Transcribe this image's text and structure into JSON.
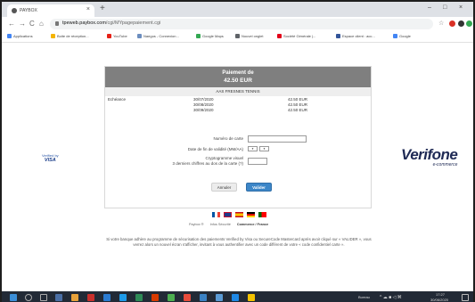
{
  "browser": {
    "tab_title": "PAYBOX",
    "tab_close": "×",
    "new_tab": "+",
    "window_controls": [
      "–",
      "□",
      "×"
    ],
    "url_host": "tpeweb.paybox.com",
    "url_path": "/cgi/MYpagepaiement.cgi",
    "bookmarks": [
      {
        "label": "Applications",
        "color": "#4285f4"
      },
      {
        "label": "Boite de réception...",
        "color": "#f4b400"
      },
      {
        "label": "YouTube",
        "color": "#e62117"
      },
      {
        "label": "Naegos - Connexion...",
        "color": "#6c8ebf"
      },
      {
        "label": "Google Maps",
        "color": "#34a853"
      },
      {
        "label": "Nouvel onglet",
        "color": "#5f6368"
      },
      {
        "label": "Société Générale |...",
        "color": "#e2001a"
      },
      {
        "label": "Espace client : acc...",
        "color": "#335599"
      },
      {
        "label": "Google",
        "color": "#4285f4"
      }
    ]
  },
  "payment": {
    "title": "Paiement de",
    "amount": "42.50 EUR",
    "merchant": "AAS FRESNES TENNIS",
    "schedule_label": "Echéance",
    "schedule": [
      {
        "date": "30/07/2020",
        "amount": "42.50 EUR"
      },
      {
        "date": "30/08/2020",
        "amount": "42.50 EUR"
      },
      {
        "date": "30/09/2020",
        "amount": "42.50 EUR"
      }
    ],
    "card_number_label": "Numéro de carte",
    "expiry_label": "Date de fin de validité (MM/AA)",
    "cvv_label_1": "Cryptogramme visuel",
    "cvv_label_2": "3 derniers chiffres au dos de la carte (?)",
    "cancel_label": "Annuler",
    "validate_label": "Valider",
    "verified_by": "Verified by",
    "visa": "VISA",
    "verifone": "Verifone",
    "verifone_sub": "e-commerce",
    "footer_links": [
      "Paybox ®",
      "Infos Sécurité",
      "Commerce / France"
    ],
    "info_text": "Si votre banque adhère au programme de sécurisation des paiements Verified by Visa ou SecureCode Mastercard après avoir cliqué sur « VALIDER », vous verrez alors un nouvel écran s'afficher, invitant à vous authentifier avec un code différent de votre « code confidentiel carte »."
  },
  "taskbar": {
    "lang": "Bureau",
    "time": "17:27",
    "date": "30/06/2020"
  }
}
